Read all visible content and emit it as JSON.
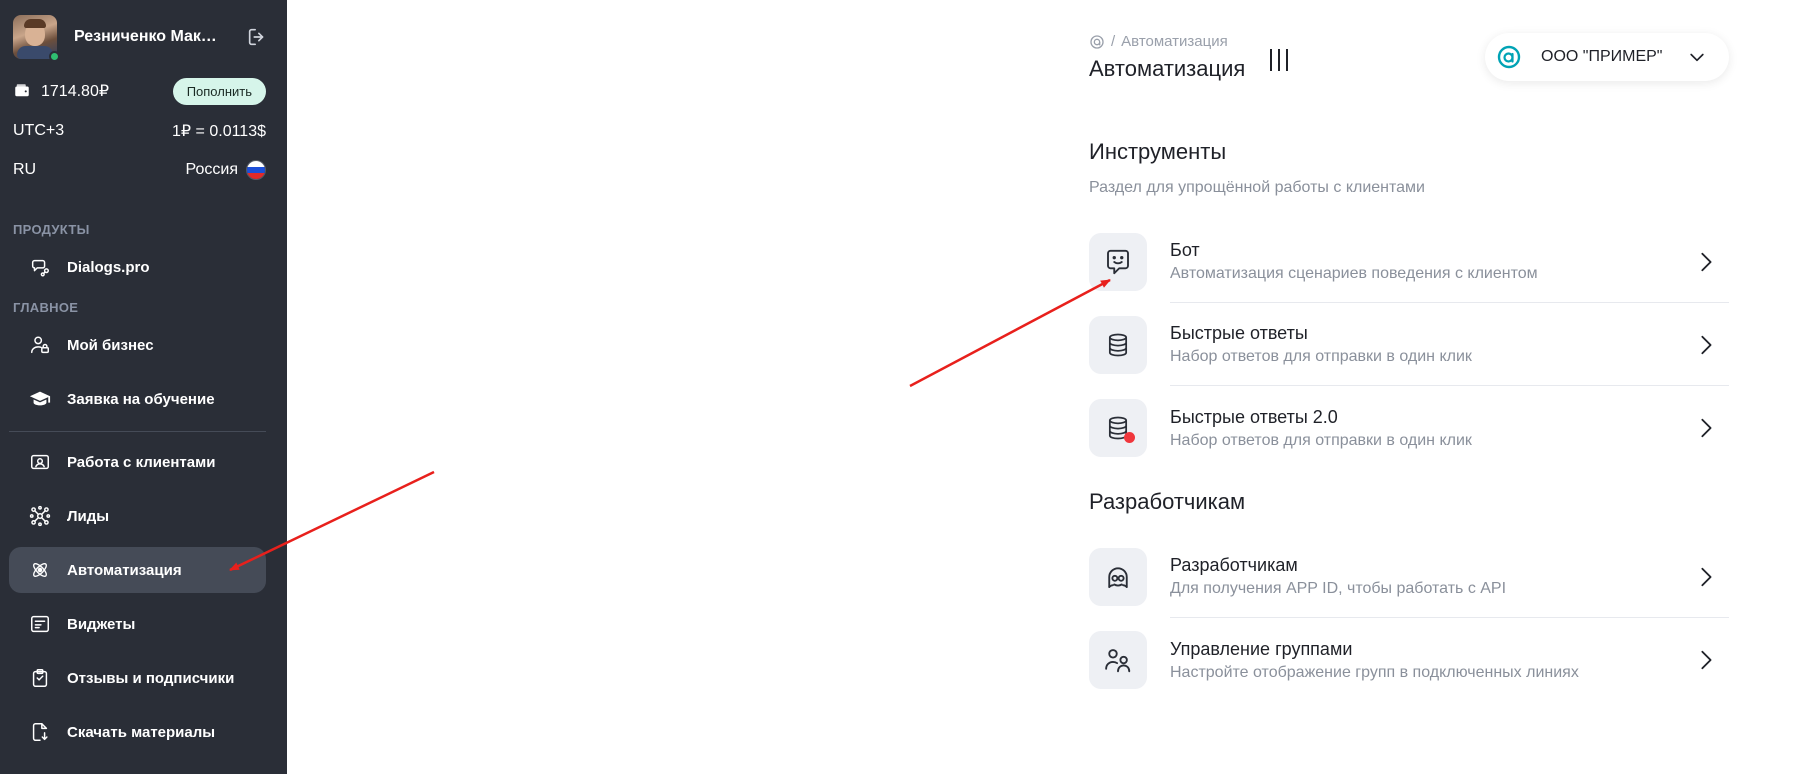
{
  "sidebar": {
    "profile": {
      "name": "Резниченко Максим"
    },
    "balance": {
      "amount": "1714.80₽",
      "topup_label": "Пополнить"
    },
    "timezone": "UTC+3",
    "rate": "1₽ = 0.0113$",
    "lang": "RU",
    "country": "Россия",
    "sections": {
      "products": "ПРОДУКТЫ",
      "main": "ГЛАВНОЕ"
    },
    "products_items": [
      {
        "label": "Dialogs.pro",
        "icon": "chat-link-icon"
      }
    ],
    "main_items": [
      {
        "label": "Мой бизнес",
        "icon": "user-lock-icon"
      },
      {
        "label": "Заявка на обучение",
        "icon": "graduation-cap-icon"
      }
    ],
    "tools_items": [
      {
        "label": "Работа с клиентами",
        "icon": "id-card-icon"
      },
      {
        "label": "Лиды",
        "icon": "network-icon"
      },
      {
        "label": "Автоматизация",
        "icon": "atom-icon",
        "active": true
      },
      {
        "label": "Виджеты",
        "icon": "widget-icon"
      },
      {
        "label": "Отзывы и подписчики",
        "icon": "clipboard-icon"
      },
      {
        "label": "Скачать материалы",
        "icon": "download-file-icon"
      }
    ],
    "colors": {
      "background": "#2a2e37",
      "active": "#454b57",
      "topup_bg": "#d6f5ea",
      "online": "#2fbf71"
    }
  },
  "header": {
    "breadcrumb": {
      "separator": "/",
      "current": "Автоматизация"
    },
    "title": "Автоматизация",
    "org": {
      "name": "ООО \"ПРИМЕР\""
    }
  },
  "main": {
    "tools": {
      "title": "Инструменты",
      "subtitle": "Раздел для упрощённой работы с клиентами",
      "items": [
        {
          "title": "Бот",
          "desc": "Автоматизация сценариев поведения с клиентом",
          "icon": "bot-chat-icon"
        },
        {
          "title": "Быстрые ответы",
          "desc": "Набор ответов для отправки в один клик",
          "icon": "database-icon"
        },
        {
          "title": "Быстрые ответы 2.0",
          "desc": "Набор ответов для отправки в один клик",
          "icon": "database-badge-icon"
        }
      ]
    },
    "dev": {
      "title": "Разработчикам",
      "items": [
        {
          "title": "Разработчикам",
          "desc": "Для получения APP ID, чтобы работать с API",
          "icon": "developer-icon"
        },
        {
          "title": "Управление группами",
          "desc": "Настройте отображение групп в подключенных линиях",
          "icon": "users-group-icon"
        }
      ]
    }
  },
  "annotation_color": "#e8201c"
}
